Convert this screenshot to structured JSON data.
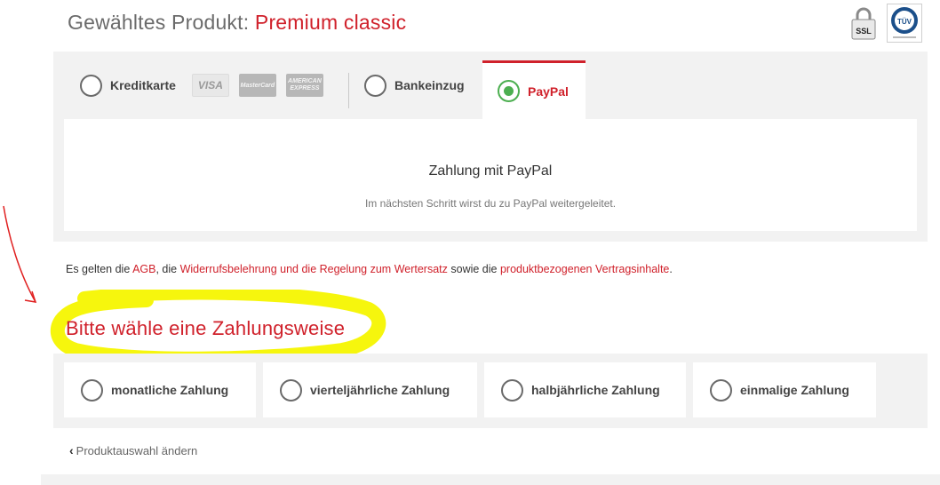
{
  "header": {
    "title_prefix": "Gewähltes Produkt: ",
    "product_name": "Premium classic",
    "ssl_badge": "SSL",
    "tuv_badge": "TÜV"
  },
  "payment_methods": {
    "kreditkarte": {
      "label": "Kreditkarte",
      "selected": false
    },
    "card_logos": [
      "VISA",
      "MasterCard",
      "AMERICAN EXPRESS"
    ],
    "bankeinzug": {
      "label": "Bankeinzug",
      "selected": false
    },
    "paypal": {
      "label": "PayPal",
      "selected": true
    }
  },
  "paypal_content": {
    "heading": "Zahlung mit PayPal",
    "text": "Im nächsten Schritt wirst du zu PayPal weitergeleitet."
  },
  "legal": {
    "part1": "Es gelten die ",
    "link_agb": "AGB",
    "part2": ", die ",
    "link_widerruf": "Widerrufsbelehrung und die Regelung zum Wertersatz",
    "part3": " sowie die ",
    "link_vertrag": "produktbezogenen Vertragsinhalte",
    "part4": "."
  },
  "interval_section": {
    "title": "Bitte wähle eine Zahlungsweise",
    "options": [
      {
        "label": "monatliche Zahlung"
      },
      {
        "label": "vierteljährliche Zahlung"
      },
      {
        "label": "halbjährliche Zahlung"
      },
      {
        "label": "einmalige Zahlung"
      }
    ]
  },
  "navigation": {
    "back_label": "Produktauswahl ändern"
  },
  "colors": {
    "accent_red": "#d0212b",
    "selected_green": "#4caf50",
    "panel_gray": "#f2f2f2",
    "highlight_yellow": "#f5f500"
  }
}
